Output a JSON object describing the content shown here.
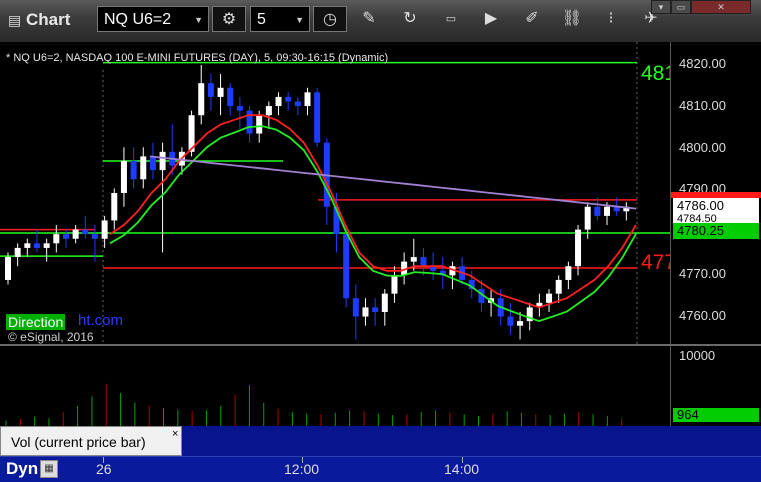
{
  "window": {
    "title": "Chart",
    "symbol": "NQ U6=2",
    "interval": "5",
    "controls": [
      "▾",
      "▭",
      "✕"
    ]
  },
  "chart_header": "* NQ U6=2, NASDAQ 100 E-MINI FUTURES (DAY), 5, 09:30-16:15 (Dynamic)",
  "watermark": {
    "brand": "Direction",
    "url": "ht.com"
  },
  "copyright": "© eSignal, 2016",
  "level_labels": {
    "upper": "481",
    "lower": "477"
  },
  "price_axis": {
    "ticks": [
      "4820.00",
      "4810.00",
      "4800.00",
      "4790.00",
      "4770.00",
      "4760.00"
    ],
    "markers": [
      {
        "text": "4786.00",
        "bg": "#ffffff",
        "fg": "#000000"
      },
      {
        "text": "4784.50",
        "bg": "#ffffff",
        "fg": "#000000"
      },
      {
        "text": "4780.25",
        "bg": "#00cc00",
        "fg": "#000000"
      }
    ]
  },
  "volume_axis": {
    "top": "10000",
    "current": "964"
  },
  "volume_tab": {
    "label": "Vol (current price bar)",
    "close": "×"
  },
  "bottom_bar": {
    "mode": "Dyn",
    "times": [
      "26",
      "12:00",
      "14:00"
    ]
  },
  "colors": {
    "up": "#ffffff",
    "down": "#1e3cff",
    "grid": "#333333",
    "vol_up": "#00a000",
    "vol_down": "#b00000",
    "level_green": "#22ff22",
    "level_red": "#ff1a1a",
    "ma_red": "#ff2020",
    "ma_green": "#22ee22",
    "vwap": "#a080d0"
  },
  "chart_data": {
    "type": "candlestick",
    "title": "* NQ U6=2, NASDAQ 100 E-MINI FUTURES (DAY), 5, 09:30-16:15 (Dynamic)",
    "ylim": [
      4756,
      4822
    ],
    "x_labels": [
      "26",
      "12:00",
      "14:00"
    ],
    "levels": [
      {
        "price": 4817.5,
        "color": "green"
      },
      {
        "price": 4787.5,
        "color": "red"
      },
      {
        "price": 4780.25,
        "color": "green"
      },
      {
        "price": 4775.2,
        "color": "green"
      },
      {
        "price": 4772.6,
        "color": "red"
      },
      {
        "price": 4781.0,
        "color": "red"
      },
      {
        "price": 4796.0,
        "color": "green"
      }
    ],
    "candles": [
      [
        4770,
        4776,
        4769,
        4775
      ],
      [
        4775,
        4778,
        4773,
        4777
      ],
      [
        4777,
        4779,
        4775,
        4778
      ],
      [
        4778,
        4781,
        4776,
        4777
      ],
      [
        4777,
        4779,
        4774,
        4778
      ],
      [
        4778,
        4782,
        4776,
        4780
      ],
      [
        4780,
        4781,
        4777,
        4779
      ],
      [
        4779,
        4782,
        4778,
        4781
      ],
      [
        4781,
        4784,
        4779,
        4780
      ],
      [
        4780,
        4782,
        4774,
        4779
      ],
      [
        4779,
        4784,
        4777,
        4783
      ],
      [
        4783,
        4790,
        4781,
        4789
      ],
      [
        4789,
        4799,
        4786,
        4796
      ],
      [
        4796,
        4799,
        4790,
        4792
      ],
      [
        4792,
        4799,
        4790,
        4797
      ],
      [
        4797,
        4800,
        4792,
        4794
      ],
      [
        4794,
        4800,
        4776,
        4798
      ],
      [
        4798,
        4804,
        4793,
        4795
      ],
      [
        4795,
        4799,
        4793,
        4798
      ],
      [
        4798,
        4807,
        4797,
        4806
      ],
      [
        4806,
        4817,
        4804,
        4813
      ],
      [
        4813,
        4815,
        4807,
        4810
      ],
      [
        4810,
        4815,
        4806,
        4812
      ],
      [
        4812,
        4813,
        4806,
        4808
      ],
      [
        4808,
        4810,
        4803,
        4807
      ],
      [
        4807,
        4808,
        4800,
        4802
      ],
      [
        4802,
        4807,
        4800,
        4806
      ],
      [
        4806,
        4809,
        4803,
        4808
      ],
      [
        4808,
        4811,
        4806,
        4810
      ],
      [
        4810,
        4811,
        4807,
        4809
      ],
      [
        4809,
        4810,
        4806,
        4808
      ],
      [
        4808,
        4812,
        4806,
        4811
      ],
      [
        4811,
        4812,
        4799,
        4800
      ],
      [
        4800,
        4801,
        4782,
        4786
      ],
      [
        4786,
        4789,
        4776,
        4780
      ],
      [
        4780,
        4782,
        4764,
        4766
      ],
      [
        4766,
        4769,
        4757,
        4762
      ],
      [
        4762,
        4766,
        4760,
        4764
      ],
      [
        4764,
        4766,
        4760,
        4763
      ],
      [
        4763,
        4768,
        4760,
        4767
      ],
      [
        4767,
        4773,
        4765,
        4771
      ],
      [
        4771,
        4776,
        4769,
        4774
      ],
      [
        4774,
        4779,
        4772,
        4775
      ],
      [
        4775,
        4777,
        4771,
        4773
      ],
      [
        4773,
        4776,
        4770,
        4772
      ],
      [
        4772,
        4775,
        4768,
        4771
      ],
      [
        4771,
        4774,
        4768,
        4773
      ],
      [
        4773,
        4775,
        4769,
        4770
      ],
      [
        4770,
        4772,
        4766,
        4768
      ],
      [
        4768,
        4770,
        4763,
        4765
      ],
      [
        4765,
        4768,
        4762,
        4766
      ],
      [
        4766,
        4768,
        4760,
        4762
      ],
      [
        4762,
        4765,
        4758,
        4760
      ],
      [
        4760,
        4763,
        4757,
        4761
      ],
      [
        4761,
        4765,
        4759,
        4764
      ],
      [
        4764,
        4767,
        4762,
        4765
      ],
      [
        4765,
        4768,
        4763,
        4767
      ],
      [
        4767,
        4771,
        4765,
        4770
      ],
      [
        4770,
        4774,
        4768,
        4773
      ],
      [
        4773,
        4782,
        4771,
        4781
      ],
      [
        4781,
        4787,
        4779,
        4786
      ],
      [
        4786,
        4788,
        4783,
        4784
      ],
      [
        4784,
        4787,
        4782,
        4786
      ],
      [
        4786,
        4788,
        4784,
        4785
      ],
      [
        4785,
        4787,
        4783,
        4786
      ]
    ],
    "ma_red": [
      4780,
      4782,
      4785,
      4789,
      4792,
      4796,
      4799,
      4802,
      4804,
      4805,
      4806,
      4806,
      4805,
      4803,
      4800,
      4795,
      4789,
      4782,
      4776,
      4773,
      4772,
      4772,
      4773,
      4773,
      4773,
      4772,
      4771,
      4769,
      4767,
      4766,
      4765,
      4764,
      4765,
      4766,
      4768,
      4770,
      4773,
      4777,
      4782
    ],
    "volume": [
      700,
      900,
      1200,
      1000,
      1800,
      2600,
      3800,
      5400,
      4200,
      3000,
      2600,
      2300,
      2100,
      1900,
      2000,
      2600,
      4000,
      5200,
      3000,
      2200,
      1800,
      1600,
      1500,
      1700,
      2000,
      1900,
      1600,
      1400,
      1500,
      1800,
      2000,
      1700,
      1500,
      1300,
      1600,
      1900,
      1700,
      1500,
      1400,
      1600,
      1800,
      1500,
      1300,
      964
    ]
  }
}
